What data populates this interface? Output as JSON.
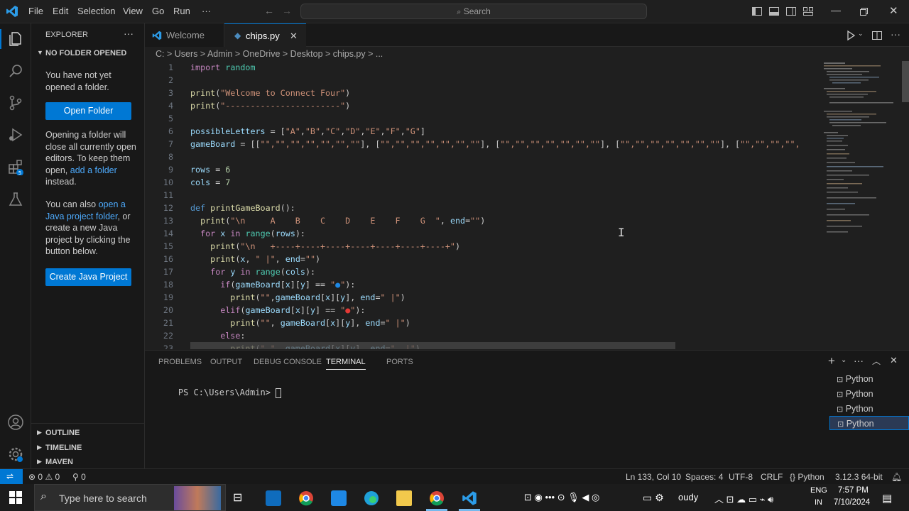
{
  "titlebar": {
    "menus": [
      "File",
      "Edit",
      "Selection",
      "View",
      "Go",
      "Run",
      "···"
    ],
    "search_placeholder": "Search"
  },
  "sidebar": {
    "title": "EXPLORER",
    "section": "NO FOLDER OPENED",
    "msg1": "You have not yet opened a folder.",
    "open_folder": "Open Folder",
    "msg2_a": "Opening a folder will close all currently open editors. To keep them open, ",
    "msg2_link": "add a folder",
    "msg2_b": " instead.",
    "msg3_a": "You can also ",
    "msg3_link": "open a Java project folder",
    "msg3_b": ", or create a new Java project by clicking the button below.",
    "create_java": "Create Java Project",
    "outline": "OUTLINE",
    "timeline": "TIMELINE",
    "maven": "MAVEN"
  },
  "tabs": {
    "welcome": "Welcome",
    "chips": "chips.py"
  },
  "breadcrumb": "C: > Users > Admin > OneDrive > Desktop > chips.py > ...",
  "code_lines": [
    {
      "n": "1",
      "t": "import random"
    },
    {
      "n": "2",
      "t": ""
    },
    {
      "n": "3",
      "t": "print(\"Welcome to Connect Four\")"
    },
    {
      "n": "4",
      "t": "print(\"-----------------------\")"
    },
    {
      "n": "5",
      "t": ""
    },
    {
      "n": "6",
      "t": "possibleLetters = [\"A\",\"B\",\"C\",\"D\",\"E\",\"F\",\"G\"]"
    },
    {
      "n": "7",
      "t": "gameBoard = [[\"\",\"\",\"\",\"\",\"\",\"\",\"\"], [\"\",\"\",\"\",\"\",\"\",\"\",\"\"], [\"\",\"\",\"\",\"\",\"\",\"\",\"\"], [\"\",\"\",\"\",\"\",\"\",\"\",\"\"], [\"\",\"\",\"\",\"\","
    },
    {
      "n": "8",
      "t": ""
    },
    {
      "n": "9",
      "t": "rows = 6"
    },
    {
      "n": "10",
      "t": "cols = 7"
    },
    {
      "n": "11",
      "t": ""
    },
    {
      "n": "12",
      "t": "def printGameBoard():"
    },
    {
      "n": "13",
      "t": "  print(\"\\n     A    B    C    D    E    F    G  \", end=\"\")"
    },
    {
      "n": "14",
      "t": "  for x in range(rows):"
    },
    {
      "n": "15",
      "t": "    print(\"\\n   +----+----+----+----+----+----+----+\")"
    },
    {
      "n": "16",
      "t": "    print(x, \" |\", end=\"\")"
    },
    {
      "n": "17",
      "t": "    for y in range(cols):"
    },
    {
      "n": "18",
      "t": "      if(gameBoard[x][y] == \"🔵\"):"
    },
    {
      "n": "19",
      "t": "        print(\"\",gameBoard[x][y], end=\" |\")"
    },
    {
      "n": "20",
      "t": "      elif(gameBoard[x][y] == \"🔴\"):"
    },
    {
      "n": "21",
      "t": "        print(\"\", gameBoard[x][y], end=\" |\")"
    },
    {
      "n": "22",
      "t": "      else:"
    },
    {
      "n": "23",
      "t": "        print(\" \", gameBoard[x][y], end=\"  |\")"
    }
  ],
  "panel": {
    "tabs": [
      "PROBLEMS",
      "OUTPUT",
      "DEBUG CONSOLE",
      "TERMINAL",
      "PORTS"
    ],
    "prompt": "PS C:\\Users\\Admin> ",
    "terminals": [
      "Python",
      "Python",
      "Python",
      "Python"
    ]
  },
  "statusbar": {
    "errors": "0",
    "warnings": "0",
    "ports": "0",
    "position": "Ln 133, Col 10",
    "spaces": "Spaces: 4",
    "encoding": "UTF-8",
    "eol": "CRLF",
    "language": "Python",
    "interpreter": "3.12.3 64-bit"
  },
  "taskbar": {
    "search_placeholder": "Type here to search",
    "weather": "oudy",
    "lang1": "ENG",
    "lang2": "IN",
    "time": "7:57 PM",
    "date": "7/10/2024"
  },
  "colors": {
    "accent": "#0078d4",
    "editor_bg": "#1f1f1f",
    "sidebar_bg": "#181818"
  }
}
